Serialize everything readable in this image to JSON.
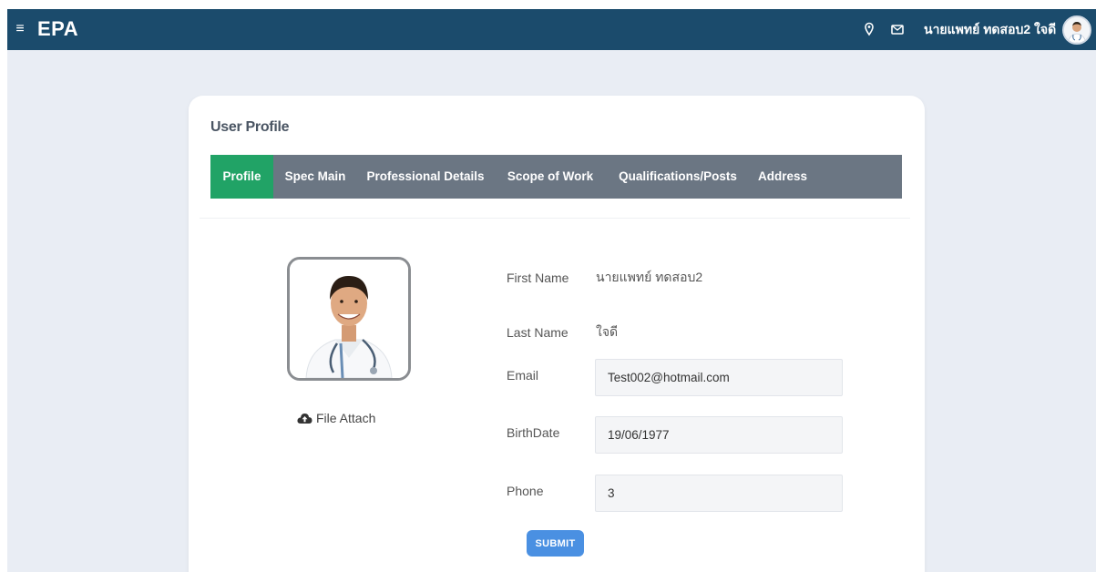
{
  "header": {
    "menu_icon": "hamburger-icon",
    "brand": "EPA",
    "icons": [
      "map-pin-icon",
      "mail-icon"
    ],
    "user_name": "นายแพทย์ ทดสอบ2 ใจดี"
  },
  "profile": {
    "title": "User Profile",
    "tabs": [
      {
        "label": "Profile",
        "active": true
      },
      {
        "label": "Spec Main",
        "active": false
      },
      {
        "label": "Professional Details",
        "active": false
      },
      {
        "label": "Scope of Work",
        "active": false
      },
      {
        "label": "Qualifications/Posts",
        "active": false
      },
      {
        "label": "Address",
        "active": false
      }
    ],
    "file_attach": "File Attach",
    "fields": {
      "first_name_label": "First Name",
      "first_name_value": "นายแพทย์ ทดสอบ2",
      "last_name_label": "Last Name",
      "last_name_value": "ใจดี",
      "email_label": "Email",
      "email_value": "Test002@hotmail.com",
      "birthdate_label": "BirthDate",
      "birthdate_value": "19/06/1977",
      "phone_label": "Phone",
      "phone_value": "3"
    },
    "submit_label": "SUBMIT"
  },
  "colors": {
    "header_bg": "#1b4b6c",
    "page_bg": "#e9edf4",
    "tabbar_bg": "#6b7683",
    "tab_active": "#21a366",
    "submit_bg": "#4a90e2"
  }
}
